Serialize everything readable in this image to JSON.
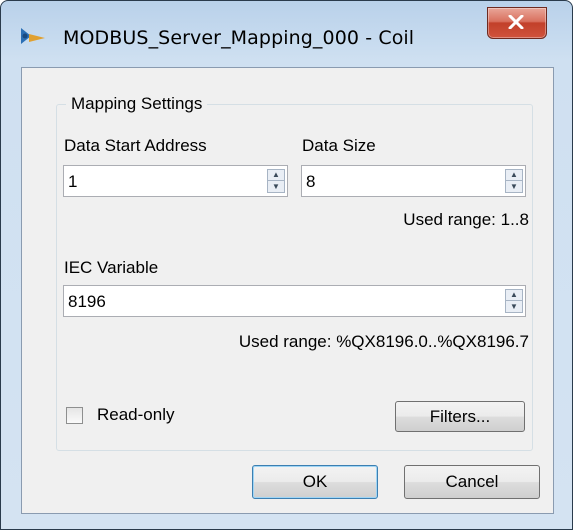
{
  "window": {
    "title": "MODBUS_Server_Mapping_000 - Coil",
    "close_icon": "close-icon",
    "app_icon": "modbus-app-icon"
  },
  "mapping_settings": {
    "group_title": "Mapping Settings",
    "data_start_address": {
      "label": "Data Start Address",
      "value": "1"
    },
    "data_size": {
      "label": "Data Size",
      "value": "8",
      "used_range": "Used range: 1..8"
    },
    "iec_variable": {
      "label": "IEC Variable",
      "value": "8196",
      "used_range": "Used range: %QX8196.0..%QX8196.7"
    },
    "read_only": {
      "label": "Read-only",
      "checked": false
    },
    "filters_button": "Filters..."
  },
  "footer": {
    "ok_label": "OK",
    "cancel_label": "Cancel"
  }
}
